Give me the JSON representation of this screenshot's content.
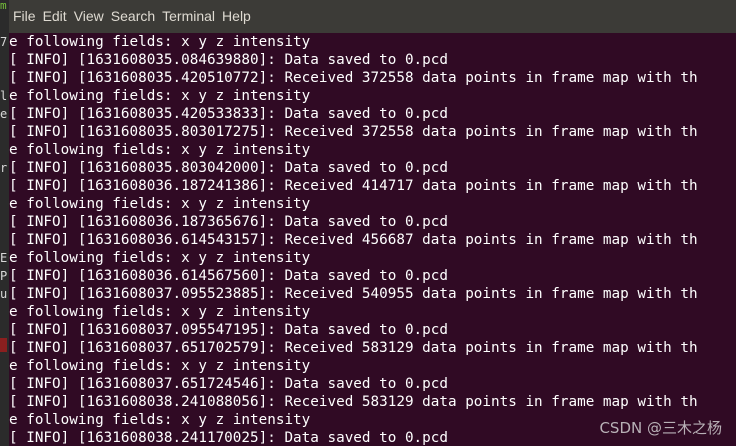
{
  "menubar": {
    "items": [
      "File",
      "Edit",
      "View",
      "Search",
      "Terminal",
      "Help"
    ]
  },
  "terminal": {
    "lines": [
      "e following fields: x y z intensity",
      "[ INFO] [1631608035.084639880]: Data saved to 0.pcd",
      "[ INFO] [1631608035.420510772]: Received 372558 data points in frame map with th",
      "e following fields: x y z intensity",
      "[ INFO] [1631608035.420533833]: Data saved to 0.pcd",
      "[ INFO] [1631608035.803017275]: Received 372558 data points in frame map with th",
      "e following fields: x y z intensity",
      "[ INFO] [1631608035.803042000]: Data saved to 0.pcd",
      "[ INFO] [1631608036.187241386]: Received 414717 data points in frame map with th",
      "e following fields: x y z intensity",
      "[ INFO] [1631608036.187365676]: Data saved to 0.pcd",
      "[ INFO] [1631608036.614543157]: Received 456687 data points in frame map with th",
      "e following fields: x y z intensity",
      "[ INFO] [1631608036.614567560]: Data saved to 0.pcd",
      "[ INFO] [1631608037.095523885]: Received 540955 data points in frame map with th",
      "e following fields: x y z intensity",
      "[ INFO] [1631608037.095547195]: Data saved to 0.pcd",
      "[ INFO] [1631608037.651702579]: Received 583129 data points in frame map with th",
      "e following fields: x y z intensity",
      "[ INFO] [1631608037.651724546]: Data saved to 0.pcd",
      "[ INFO] [1631608038.241088056]: Received 583129 data points in frame map with th",
      "e following fields: x y z intensity",
      "[ INFO] [1631608038.241170025]: Data saved to 0.pcd"
    ]
  },
  "left_strip": {
    "top_glyph": "m",
    "marks": [
      "7",
      "",
      "",
      "l",
      "e",
      "",
      "",
      "r",
      "",
      "",
      "",
      "",
      "E",
      "P",
      "u",
      "",
      "",
      "",
      "",
      "",
      "",
      "",
      ""
    ]
  },
  "watermark": "CSDN @三木之杨",
  "colors": {
    "terminal_bg": "#300a24",
    "menubar_bg": "#3c3b37",
    "text": "#ffffff"
  }
}
